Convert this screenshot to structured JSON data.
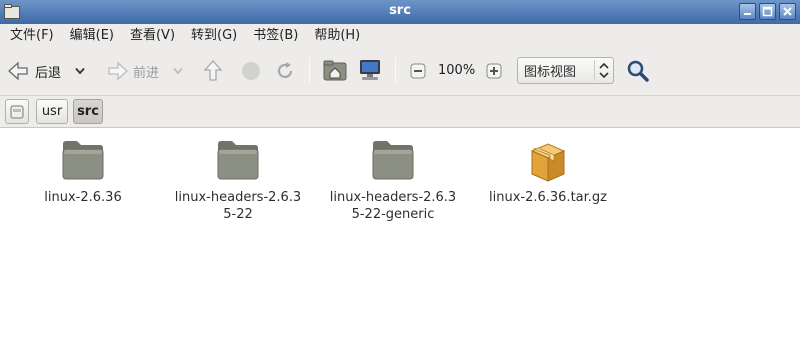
{
  "window": {
    "title": "src"
  },
  "menubar": {
    "items": [
      "文件(F)",
      "编辑(E)",
      "查看(V)",
      "转到(G)",
      "书签(B)",
      "帮助(H)"
    ]
  },
  "toolbar": {
    "back_label": "后退",
    "forward_label": "前进",
    "zoom_level": "100%",
    "view_mode": "图标视图"
  },
  "pathbar": {
    "crumbs": [
      "usr",
      "src"
    ],
    "active": "src"
  },
  "files": [
    {
      "name": "linux-2.6.36",
      "type": "folder"
    },
    {
      "name": "linux-headers-2.6.35-22",
      "type": "folder"
    },
    {
      "name": "linux-headers-2.6.35-22-generic",
      "type": "folder"
    },
    {
      "name": "linux-2.6.36.tar.gz",
      "type": "archive"
    }
  ],
  "colors": {
    "titlebar": "#4f7bb8",
    "folder": "#8a8e7f",
    "archive": "#e1a33a"
  }
}
